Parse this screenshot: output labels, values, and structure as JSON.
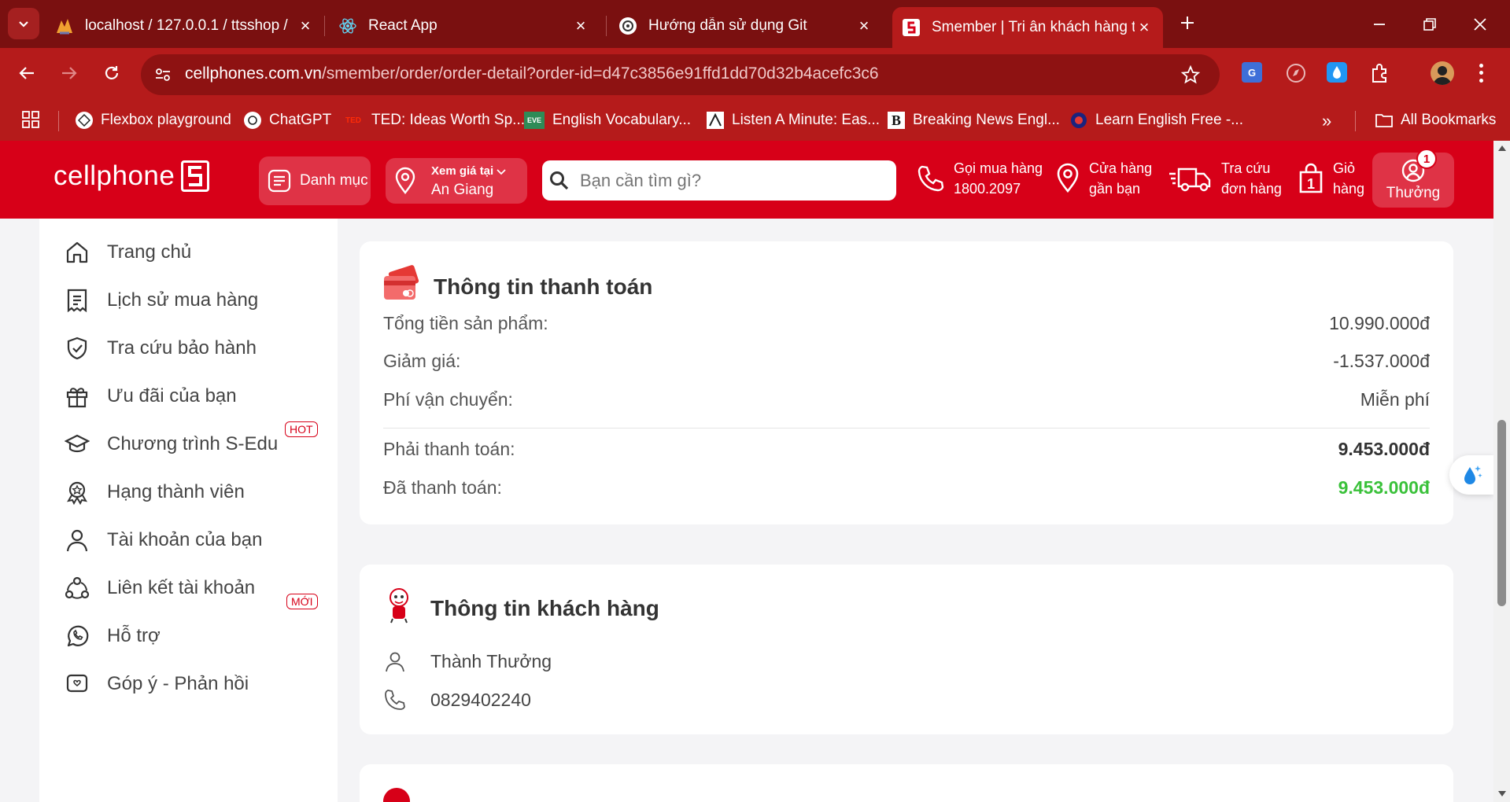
{
  "browser": {
    "tabs": [
      {
        "title": "localhost / 127.0.0.1 / ttsshop /",
        "icon": "phpmyadmin-icon"
      },
      {
        "title": "React App",
        "icon": "react-icon"
      },
      {
        "title": "Hướng dẫn sử dụng Git",
        "icon": "chatgpt-icon"
      },
      {
        "title": "Smember | Tri ân khách hàng th",
        "icon": "smember-icon",
        "active": true
      }
    ],
    "url_host": "cellphones.com.vn",
    "url_path": "/smember/order/order-detail?order-id=d47c3856e91ffd1dd70d32b4acefc3c6",
    "bookmarks": [
      {
        "label": "Flexbox playground",
        "icon": "flexbox-icon"
      },
      {
        "label": "ChatGPT",
        "icon": "chatgpt-icon"
      },
      {
        "label": "TED: Ideas Worth Sp...",
        "icon": "ted-icon",
        "badge": "TED"
      },
      {
        "label": "English Vocabulary...",
        "icon": "eve-icon",
        "badge": "EVE"
      },
      {
        "label": "Listen A Minute: Eas...",
        "icon": "listen-icon"
      },
      {
        "label": "Breaking News Engl...",
        "icon": "breaking-news-icon",
        "badge": "B"
      },
      {
        "label": "Learn English Free -...",
        "icon": "learn-english-icon"
      }
    ],
    "all_bookmarks": "All Bookmarks",
    "colors": {
      "tabstrip": "#7a1010",
      "toolbar": "#b51b1b"
    }
  },
  "header": {
    "logo": "cellphone S",
    "menu_label": "Danh mục",
    "location_label": "Xem giá tại",
    "location_value": "An Giang",
    "search_placeholder": "Bạn cần tìm gì?",
    "call_line1": "Gọi mua hàng",
    "call_line2": "1800.2097",
    "store_line1": "Cửa hàng",
    "store_line2": "gần bạn",
    "track_line1": "Tra cứu",
    "track_line2": "đơn hàng",
    "cart_line1": "Giỏ",
    "cart_line2": "hàng",
    "cart_count": "1",
    "account_badge": "1",
    "account_label": "Thưởng",
    "brand_color": "#d70018"
  },
  "sidebar": {
    "items": [
      {
        "label": "Trang chủ",
        "icon": "home-icon"
      },
      {
        "label": "Lịch sử mua hàng",
        "icon": "receipt-icon"
      },
      {
        "label": "Tra cứu bảo hành",
        "icon": "shield-check-icon"
      },
      {
        "label": "Ưu đãi của bạn",
        "icon": "gift-icon"
      },
      {
        "label": "Chương trình S-Edu",
        "icon": "graduation-cap-icon",
        "tag": "HOT"
      },
      {
        "label": "Hạng thành viên",
        "icon": "award-icon"
      },
      {
        "label": "Tài khoản của bạn",
        "icon": "user-icon"
      },
      {
        "label": "Liên kết tài khoản",
        "icon": "link-accounts-icon",
        "tag": "MỚI"
      },
      {
        "label": "Hỗ trợ",
        "icon": "whatsapp-icon"
      },
      {
        "label": "Góp ý - Phản hồi",
        "icon": "feedback-icon"
      }
    ]
  },
  "payment": {
    "title": "Thông tin thanh toán",
    "rows": [
      {
        "label": "Tổng tiền sản phẩm:",
        "value": "10.990.000đ"
      },
      {
        "label": "Giảm giá:",
        "value": "-1.537.000đ"
      },
      {
        "label": "Phí vận chuyển:",
        "value": "Miễn phí"
      }
    ],
    "must_pay_label": "Phải thanh toán:",
    "must_pay_value": "9.453.000đ",
    "paid_label": "Đã thanh toán:",
    "paid_value": "9.453.000đ",
    "paid_color": "#3ac13a"
  },
  "customer": {
    "title": "Thông tin khách hàng",
    "name": "Thành Thưởng",
    "phone": "0829402240"
  }
}
